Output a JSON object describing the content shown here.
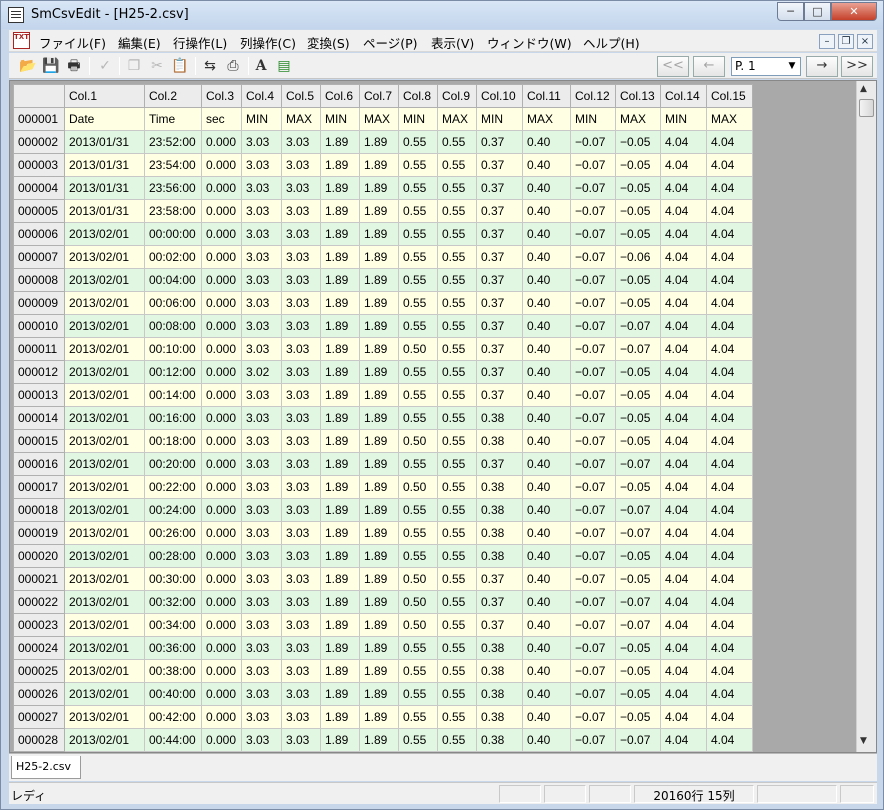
{
  "window": {
    "title": "SmCsvEdit - [H25-2.csv]"
  },
  "menu": [
    {
      "label": "ファイル(F)"
    },
    {
      "label": "編集(E)"
    },
    {
      "label": "行操作(L)"
    },
    {
      "label": "列操作(C)"
    },
    {
      "label": "変換(S)"
    },
    {
      "label": "ページ(P)"
    },
    {
      "label": "表示(V)"
    },
    {
      "label": "ウィンドウ(W)"
    },
    {
      "label": "ヘルプ(H)"
    }
  ],
  "toolbar": {
    "page_value": "P. 1",
    "nav_first": "<<",
    "nav_prev": "←",
    "nav_next": "→",
    "nav_last": ">>"
  },
  "grid": {
    "columns": [
      "",
      "Col.1",
      "Col.2",
      "Col.3",
      "Col.4",
      "Col.5",
      "Col.6",
      "Col.7",
      "Col.8",
      "Col.9",
      "Col.10",
      "Col.11",
      "Col.12",
      "Col.13",
      "Col.14",
      "Col.15"
    ],
    "rows": [
      [
        "000001",
        "Date",
        "Time",
        "sec",
        "MIN",
        "MAX",
        "MIN",
        "MAX",
        "MIN",
        "MAX",
        "MIN",
        "MAX",
        "MIN",
        "MAX",
        "MIN",
        "MAX"
      ],
      [
        "000002",
        "2013/01/31",
        "23:52:00",
        "0.000",
        "3.03",
        "3.03",
        "1.89",
        "1.89",
        "0.55",
        "0.55",
        "0.37",
        "0.40",
        "−0.07",
        "−0.05",
        "4.04",
        "4.04"
      ],
      [
        "000003",
        "2013/01/31",
        "23:54:00",
        "0.000",
        "3.03",
        "3.03",
        "1.89",
        "1.89",
        "0.55",
        "0.55",
        "0.37",
        "0.40",
        "−0.07",
        "−0.05",
        "4.04",
        "4.04"
      ],
      [
        "000004",
        "2013/01/31",
        "23:56:00",
        "0.000",
        "3.03",
        "3.03",
        "1.89",
        "1.89",
        "0.55",
        "0.55",
        "0.37",
        "0.40",
        "−0.07",
        "−0.05",
        "4.04",
        "4.04"
      ],
      [
        "000005",
        "2013/01/31",
        "23:58:00",
        "0.000",
        "3.03",
        "3.03",
        "1.89",
        "1.89",
        "0.55",
        "0.55",
        "0.37",
        "0.40",
        "−0.07",
        "−0.05",
        "4.04",
        "4.04"
      ],
      [
        "000006",
        "2013/02/01",
        "00:00:00",
        "0.000",
        "3.03",
        "3.03",
        "1.89",
        "1.89",
        "0.55",
        "0.55",
        "0.37",
        "0.40",
        "−0.07",
        "−0.05",
        "4.04",
        "4.04"
      ],
      [
        "000007",
        "2013/02/01",
        "00:02:00",
        "0.000",
        "3.03",
        "3.03",
        "1.89",
        "1.89",
        "0.55",
        "0.55",
        "0.37",
        "0.40",
        "−0.07",
        "−0.06",
        "4.04",
        "4.04"
      ],
      [
        "000008",
        "2013/02/01",
        "00:04:00",
        "0.000",
        "3.03",
        "3.03",
        "1.89",
        "1.89",
        "0.55",
        "0.55",
        "0.37",
        "0.40",
        "−0.07",
        "−0.05",
        "4.04",
        "4.04"
      ],
      [
        "000009",
        "2013/02/01",
        "00:06:00",
        "0.000",
        "3.03",
        "3.03",
        "1.89",
        "1.89",
        "0.55",
        "0.55",
        "0.37",
        "0.40",
        "−0.07",
        "−0.05",
        "4.04",
        "4.04"
      ],
      [
        "000010",
        "2013/02/01",
        "00:08:00",
        "0.000",
        "3.03",
        "3.03",
        "1.89",
        "1.89",
        "0.55",
        "0.55",
        "0.37",
        "0.40",
        "−0.07",
        "−0.07",
        "4.04",
        "4.04"
      ],
      [
        "000011",
        "2013/02/01",
        "00:10:00",
        "0.000",
        "3.03",
        "3.03",
        "1.89",
        "1.89",
        "0.50",
        "0.55",
        "0.37",
        "0.40",
        "−0.07",
        "−0.07",
        "4.04",
        "4.04"
      ],
      [
        "000012",
        "2013/02/01",
        "00:12:00",
        "0.000",
        "3.02",
        "3.03",
        "1.89",
        "1.89",
        "0.55",
        "0.55",
        "0.37",
        "0.40",
        "−0.07",
        "−0.05",
        "4.04",
        "4.04"
      ],
      [
        "000013",
        "2013/02/01",
        "00:14:00",
        "0.000",
        "3.03",
        "3.03",
        "1.89",
        "1.89",
        "0.55",
        "0.55",
        "0.37",
        "0.40",
        "−0.07",
        "−0.05",
        "4.04",
        "4.04"
      ],
      [
        "000014",
        "2013/02/01",
        "00:16:00",
        "0.000",
        "3.03",
        "3.03",
        "1.89",
        "1.89",
        "0.55",
        "0.55",
        "0.38",
        "0.40",
        "−0.07",
        "−0.05",
        "4.04",
        "4.04"
      ],
      [
        "000015",
        "2013/02/01",
        "00:18:00",
        "0.000",
        "3.03",
        "3.03",
        "1.89",
        "1.89",
        "0.50",
        "0.55",
        "0.38",
        "0.40",
        "−0.07",
        "−0.05",
        "4.04",
        "4.04"
      ],
      [
        "000016",
        "2013/02/01",
        "00:20:00",
        "0.000",
        "3.03",
        "3.03",
        "1.89",
        "1.89",
        "0.55",
        "0.55",
        "0.37",
        "0.40",
        "−0.07",
        "−0.07",
        "4.04",
        "4.04"
      ],
      [
        "000017",
        "2013/02/01",
        "00:22:00",
        "0.000",
        "3.03",
        "3.03",
        "1.89",
        "1.89",
        "0.50",
        "0.55",
        "0.38",
        "0.40",
        "−0.07",
        "−0.05",
        "4.04",
        "4.04"
      ],
      [
        "000018",
        "2013/02/01",
        "00:24:00",
        "0.000",
        "3.03",
        "3.03",
        "1.89",
        "1.89",
        "0.55",
        "0.55",
        "0.38",
        "0.40",
        "−0.07",
        "−0.07",
        "4.04",
        "4.04"
      ],
      [
        "000019",
        "2013/02/01",
        "00:26:00",
        "0.000",
        "3.03",
        "3.03",
        "1.89",
        "1.89",
        "0.55",
        "0.55",
        "0.38",
        "0.40",
        "−0.07",
        "−0.07",
        "4.04",
        "4.04"
      ],
      [
        "000020",
        "2013/02/01",
        "00:28:00",
        "0.000",
        "3.03",
        "3.03",
        "1.89",
        "1.89",
        "0.55",
        "0.55",
        "0.38",
        "0.40",
        "−0.07",
        "−0.05",
        "4.04",
        "4.04"
      ],
      [
        "000021",
        "2013/02/01",
        "00:30:00",
        "0.000",
        "3.03",
        "3.03",
        "1.89",
        "1.89",
        "0.50",
        "0.55",
        "0.37",
        "0.40",
        "−0.07",
        "−0.05",
        "4.04",
        "4.04"
      ],
      [
        "000022",
        "2013/02/01",
        "00:32:00",
        "0.000",
        "3.03",
        "3.03",
        "1.89",
        "1.89",
        "0.50",
        "0.55",
        "0.37",
        "0.40",
        "−0.07",
        "−0.07",
        "4.04",
        "4.04"
      ],
      [
        "000023",
        "2013/02/01",
        "00:34:00",
        "0.000",
        "3.03",
        "3.03",
        "1.89",
        "1.89",
        "0.50",
        "0.55",
        "0.37",
        "0.40",
        "−0.07",
        "−0.07",
        "4.04",
        "4.04"
      ],
      [
        "000024",
        "2013/02/01",
        "00:36:00",
        "0.000",
        "3.03",
        "3.03",
        "1.89",
        "1.89",
        "0.55",
        "0.55",
        "0.38",
        "0.40",
        "−0.07",
        "−0.05",
        "4.04",
        "4.04"
      ],
      [
        "000025",
        "2013/02/01",
        "00:38:00",
        "0.000",
        "3.03",
        "3.03",
        "1.89",
        "1.89",
        "0.55",
        "0.55",
        "0.38",
        "0.40",
        "−0.07",
        "−0.05",
        "4.04",
        "4.04"
      ],
      [
        "000026",
        "2013/02/01",
        "00:40:00",
        "0.000",
        "3.03",
        "3.03",
        "1.89",
        "1.89",
        "0.55",
        "0.55",
        "0.38",
        "0.40",
        "−0.07",
        "−0.05",
        "4.04",
        "4.04"
      ],
      [
        "000027",
        "2013/02/01",
        "00:42:00",
        "0.000",
        "3.03",
        "3.03",
        "1.89",
        "1.89",
        "0.55",
        "0.55",
        "0.38",
        "0.40",
        "−0.07",
        "−0.05",
        "4.04",
        "4.04"
      ],
      [
        "000028",
        "2013/02/01",
        "00:44:00",
        "0.000",
        "3.03",
        "3.03",
        "1.89",
        "1.89",
        "0.55",
        "0.55",
        "0.38",
        "0.40",
        "−0.07",
        "−0.07",
        "4.04",
        "4.04"
      ]
    ]
  },
  "tabs": [
    {
      "label": "H25-2.csv"
    }
  ],
  "status": {
    "text": "レディ",
    "count": "20160行 15列"
  }
}
